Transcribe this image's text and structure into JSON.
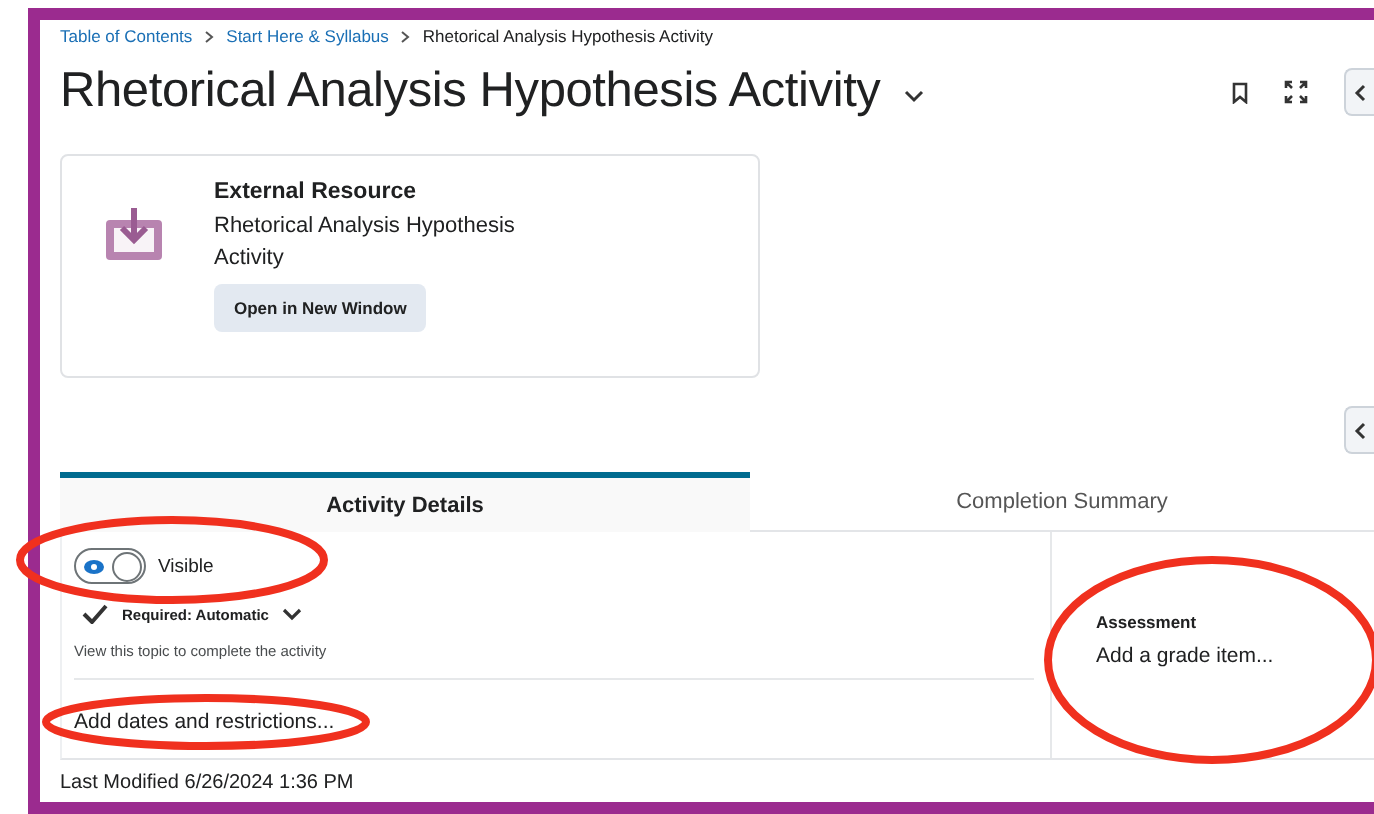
{
  "breadcrumb": [
    {
      "label": "Table of Contents",
      "link": true
    },
    {
      "label": "Start Here & Syllabus",
      "link": true
    },
    {
      "label": "Rhetorical Analysis Hypothesis Activity",
      "link": false
    }
  ],
  "title": "Rhetorical Analysis Hypothesis Activity",
  "resource": {
    "type": "External Resource",
    "name": "Rhetorical Analysis Hypothesis Activity",
    "button": "Open in New Window"
  },
  "tabs": [
    {
      "label": "Activity Details",
      "selected": true
    },
    {
      "label": "Completion Summary",
      "selected": false
    }
  ],
  "visibility": {
    "on": true,
    "label": "Visible"
  },
  "completion": {
    "label": "Required: Automatic",
    "hint": "View this topic to complete the activity"
  },
  "dates_link": "Add dates and restrictions...",
  "assessment": {
    "heading": "Assessment",
    "link": "Add a grade item..."
  },
  "last_modified": "Last Modified 6/26/2024 1:36 PM"
}
